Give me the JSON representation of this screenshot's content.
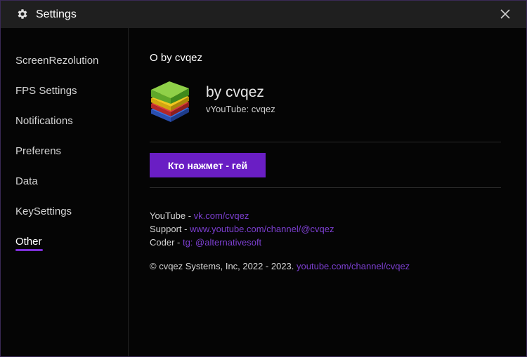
{
  "window": {
    "title": "Settings",
    "close_icon": "close-icon",
    "settings_icon": "gear-icon"
  },
  "sidebar": {
    "items": [
      {
        "label": "ScreenRezolution"
      },
      {
        "label": "FPS Settings"
      },
      {
        "label": "Notifications"
      },
      {
        "label": "Preferens"
      },
      {
        "label": "Data"
      },
      {
        "label": "KeySettings"
      },
      {
        "label": "Other",
        "active": true
      }
    ],
    "accent_color": "#7c2fd6"
  },
  "about": {
    "heading": "О by cvqez",
    "app_name": "by cvqez",
    "app_sub": "vYouTube: cvqez",
    "button_label": "Кто нажмет - гей",
    "button_color": "#6a1ec4"
  },
  "info": {
    "youtube_label": "YouTube - ",
    "youtube_link": "vk.com/cvqez",
    "support_label": "Support - ",
    "support_link": "www.youtube.com/channel/@cvqez",
    "coder_label": "Coder - ",
    "coder_link": "tg: @alternativesoft",
    "copyright_text": "© cvqez Systems, Inc, 2022 - 2023. ",
    "copyright_link": "youtube.com/channel/cvqez",
    "link_color": "#7c3fd0"
  }
}
